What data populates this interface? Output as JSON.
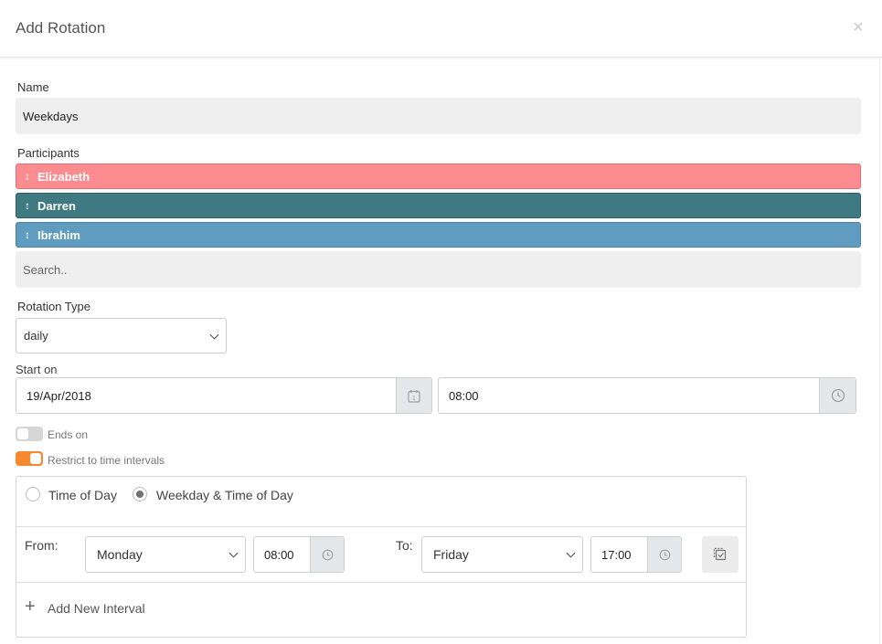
{
  "dialog": {
    "title": "Add Rotation",
    "close_glyph": "×"
  },
  "name": {
    "label": "Name",
    "value": "Weekdays"
  },
  "participants": {
    "label": "Participants",
    "items": [
      {
        "label": "Elizabeth",
        "color": "#fc8c8f"
      },
      {
        "label": "Darren",
        "color": "#3f7a83"
      },
      {
        "label": "Ibrahim",
        "color": "#5f9cbf"
      }
    ],
    "handle_glyph": "↕",
    "search_placeholder": "Search.."
  },
  "rotation_type": {
    "label": "Rotation Type",
    "value": "daily"
  },
  "start_on": {
    "label": "Start on",
    "date": "19/Apr/2018",
    "time": "08:00"
  },
  "ends_on": {
    "label": "Ends on",
    "enabled": false
  },
  "restrict": {
    "label": "Restrict to time intervals",
    "enabled": true,
    "accent": "#f7882f"
  },
  "interval_mode": {
    "options": [
      {
        "label": "Time of Day",
        "selected": false
      },
      {
        "label": "Weekday & Time of Day",
        "selected": true
      }
    ]
  },
  "interval": {
    "from_label": "From:",
    "from_day": "Monday",
    "from_time": "08:00",
    "to_label": "To:",
    "to_day": "Friday",
    "to_time": "17:00"
  },
  "add_interval": {
    "icon": "+",
    "label": "Add New Interval"
  }
}
